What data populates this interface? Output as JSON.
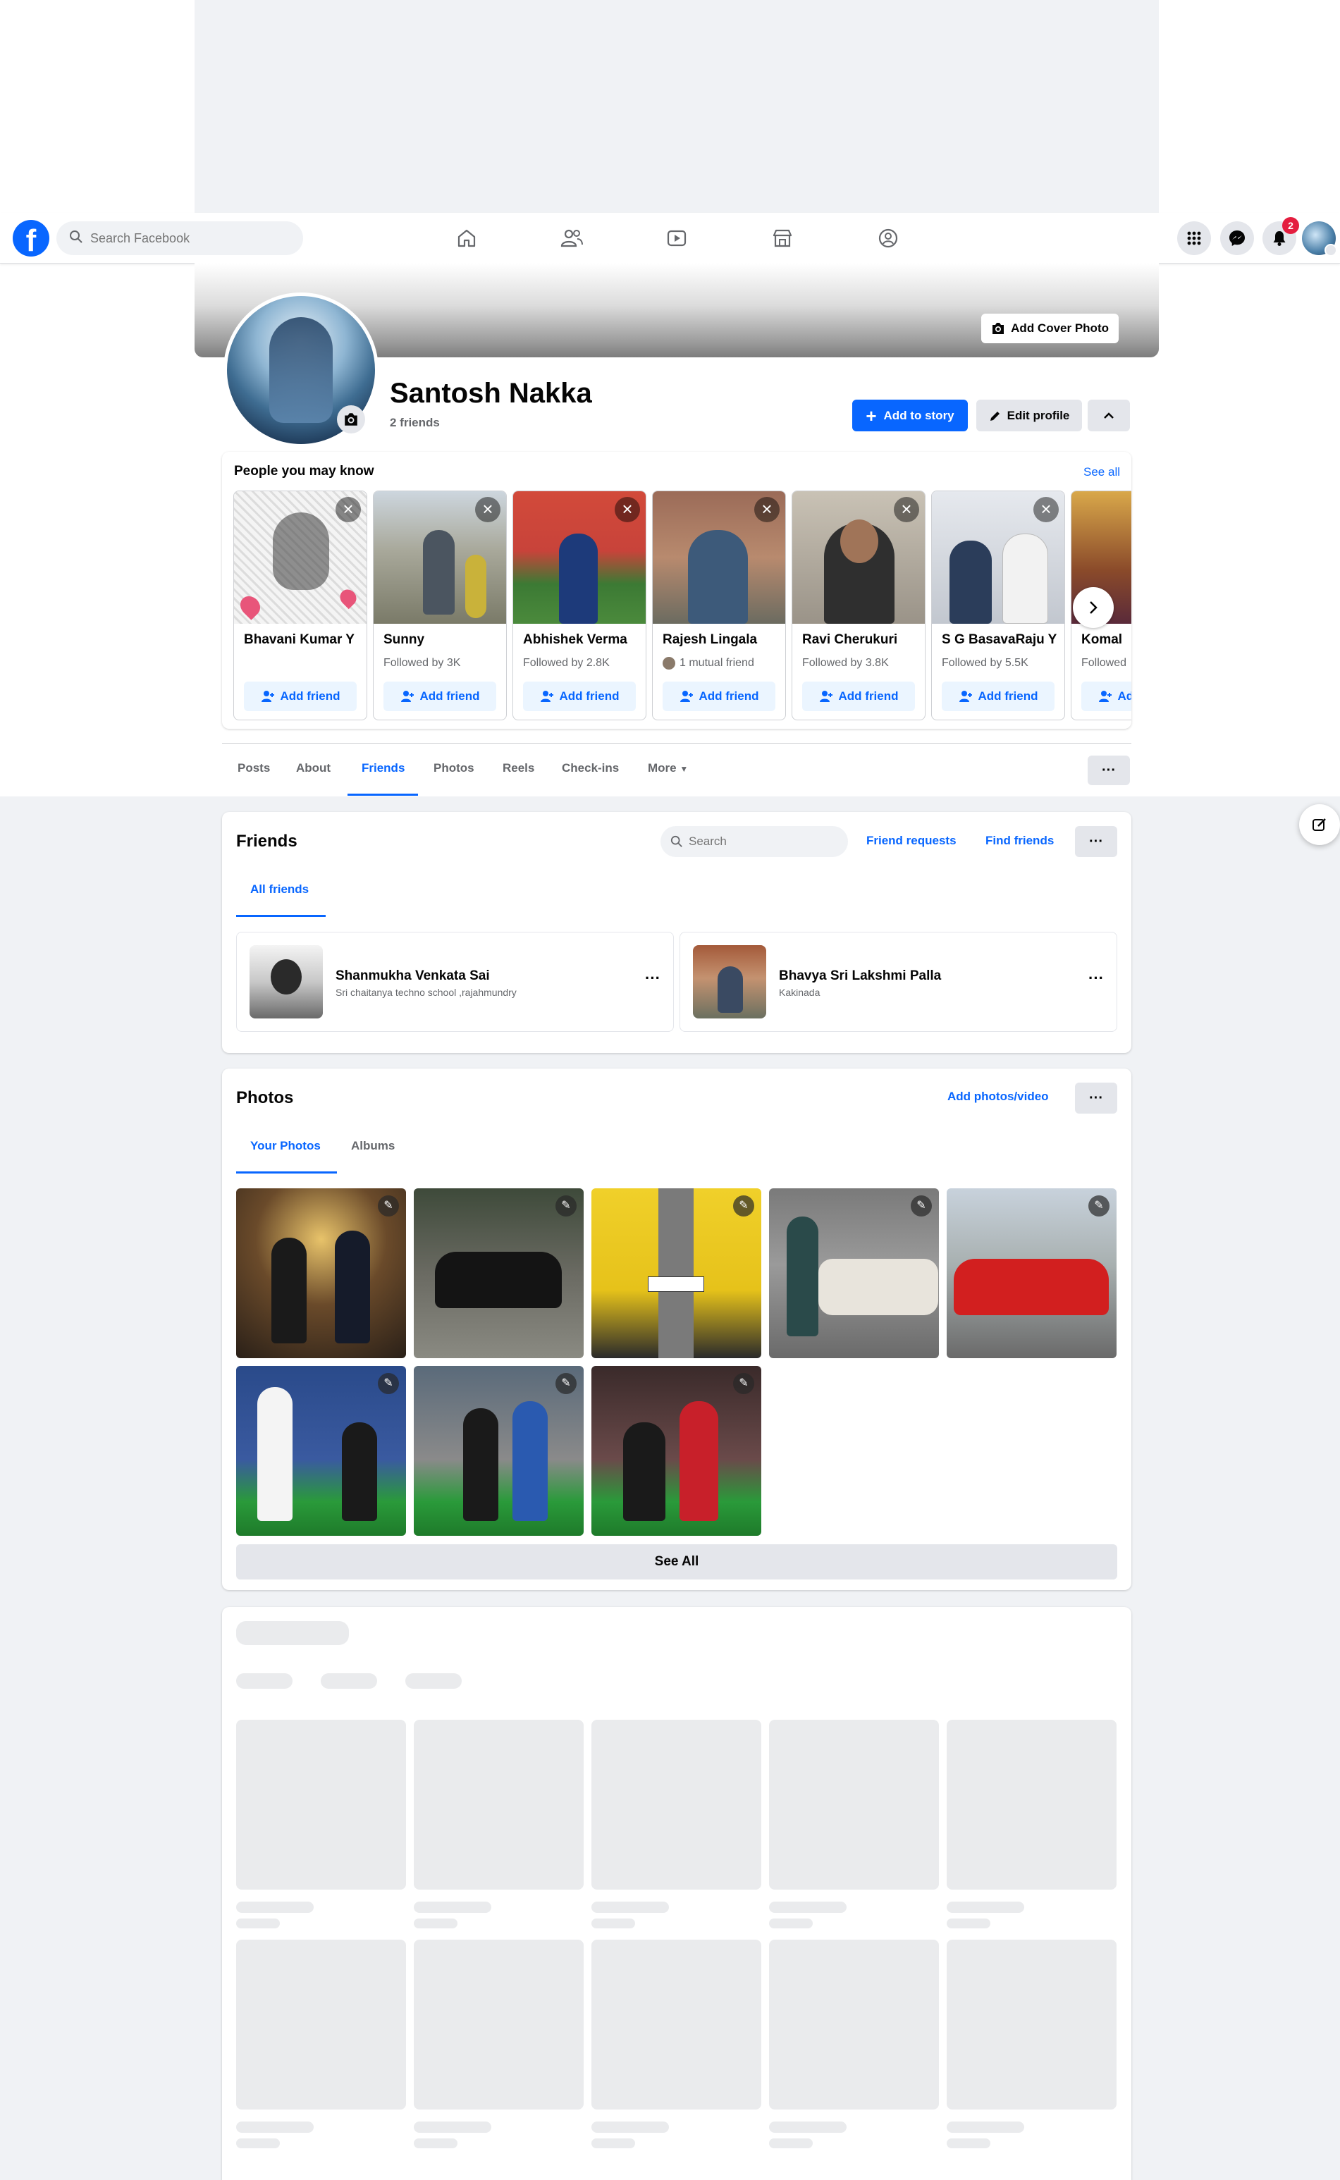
{
  "nav": {
    "search_placeholder": "Search Facebook",
    "notification_count": "2",
    "icons": [
      "home-icon",
      "friends-icon",
      "video-icon",
      "marketplace-icon",
      "groups-icon",
      "menu-grid-icon",
      "messenger-icon",
      "bell-icon"
    ]
  },
  "cover": {
    "add_cover_label": "Add Cover Photo"
  },
  "profile": {
    "name": "Santosh Nakka",
    "friends_count": "2 friends",
    "add_story_label": "Add to story",
    "edit_profile_label": "Edit profile"
  },
  "pymk": {
    "title": "People you may know",
    "see_all": "See all",
    "add_label": "Add friend",
    "people": [
      {
        "name": "Bhavani Kumar Y",
        "sub": ""
      },
      {
        "name": "Sunny",
        "sub": "Followed by 3K"
      },
      {
        "name": "Abhishek Verma",
        "sub": "Followed by 2.8K"
      },
      {
        "name": "Rajesh Lingala",
        "sub": "1 mutual friend"
      },
      {
        "name": "Ravi Cherukuri",
        "sub": "Followed by 3.8K"
      },
      {
        "name": "S G BasavaRaju Y",
        "sub": "Followed by 5.5K"
      },
      {
        "name": "Komal",
        "sub": "Followed"
      }
    ]
  },
  "tabs": {
    "posts": "Posts",
    "about": "About",
    "friends": "Friends",
    "photos": "Photos",
    "reels": "Reels",
    "checkins": "Check-ins",
    "more": "More"
  },
  "friends_section": {
    "title": "Friends",
    "search_placeholder": "Search",
    "friend_requests": "Friend requests",
    "find_friends": "Find friends",
    "all_friends_tab": "All friends",
    "list": [
      {
        "name": "Shanmukha Venkata Sai",
        "sub": "Sri chaitanya techno school ,rajahmundry"
      },
      {
        "name": "Bhavya Sri Lakshmi Palla",
        "sub": "Kakinada"
      }
    ]
  },
  "photos_section": {
    "title": "Photos",
    "add_label": "Add photos/video",
    "tab_your_photos": "Your Photos",
    "tab_albums": "Albums",
    "see_all": "See All"
  },
  "colors": {
    "accent": "#0866ff",
    "badge": "#e41e3f"
  }
}
